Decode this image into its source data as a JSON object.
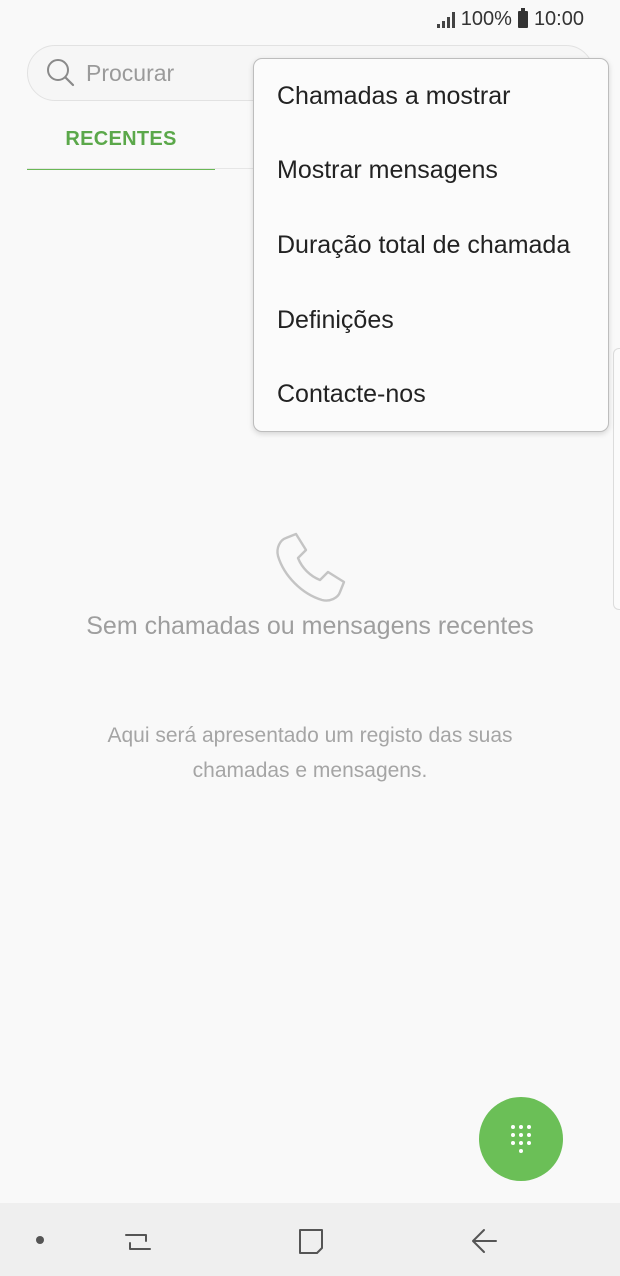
{
  "status_bar": {
    "battery": "100%",
    "time": "10:00"
  },
  "search": {
    "placeholder": "Procurar"
  },
  "tabs": [
    {
      "label": "RECENTES",
      "active": true
    }
  ],
  "menu": {
    "items": [
      "Chamadas a mostrar",
      "Mostrar mensagens",
      "Duração total de chamada",
      "Definições",
      "Contacte-nos"
    ]
  },
  "empty_state": {
    "title": "Sem chamadas ou mensagens recentes",
    "description": "Aqui será apresentado um registo das suas chamadas e mensagens."
  },
  "icons": {
    "search": "search-icon",
    "phone": "phone-icon",
    "dialpad": "dialpad-icon",
    "recent_apps": "recent-apps-icon",
    "home": "home-icon",
    "back": "back-icon"
  },
  "colors": {
    "accent": "#6bbf57",
    "tab_text": "#5ba84a",
    "background": "#f9f9f9"
  }
}
